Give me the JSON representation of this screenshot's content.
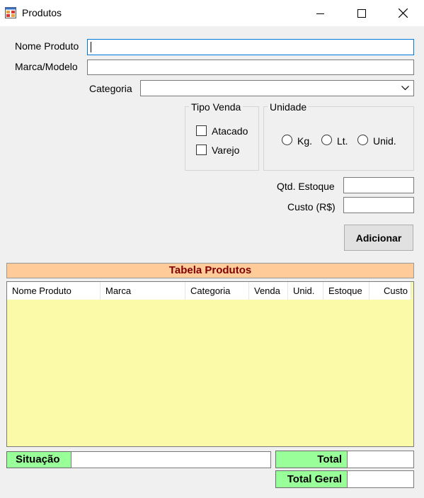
{
  "window": {
    "title": "Produtos",
    "icon": "app-form-icon",
    "controls": [
      "minimize-icon",
      "maximize-icon",
      "close-icon"
    ]
  },
  "form": {
    "nome_label": "Nome Produto",
    "nome_value": "",
    "marca_label": "Marca/Modelo",
    "marca_value": "",
    "categoria_label": "Categoria",
    "categoria_value": "",
    "tipo_venda": {
      "title": "Tipo Venda",
      "atacado": "Atacado",
      "varejo": "Varejo"
    },
    "unidade": {
      "title": "Unidade",
      "kg": "Kg.",
      "lt": "Lt.",
      "unid": "Unid."
    },
    "qtd_label": "Qtd. Estoque",
    "qtd_value": "",
    "custo_label": "Custo (R$)",
    "custo_value": "",
    "add_button": "Adicionar"
  },
  "table": {
    "title": "Tabela Produtos",
    "columns": [
      "Nome Produto",
      "Marca",
      "Categoria",
      "Venda",
      "Unid.",
      "Estoque",
      "Custo"
    ],
    "rows": []
  },
  "footer": {
    "situacao_label": "Situação",
    "situacao_value": "",
    "total_label": "Total",
    "total_value": "",
    "total_geral_label": "Total Geral",
    "total_geral_value": ""
  },
  "colors": {
    "table_title_bg": "#ffcc99",
    "table_title_fg": "#800000",
    "grid_bg": "#fafaa9",
    "status_label_bg": "#99ff99",
    "focus_border": "#0078d7"
  }
}
